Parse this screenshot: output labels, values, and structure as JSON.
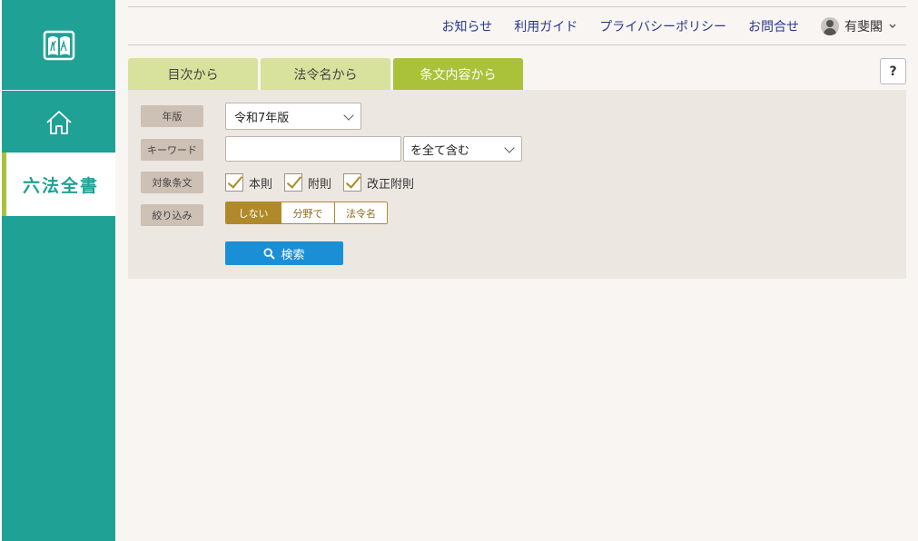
{
  "sidebar": {
    "logo_icon": "book-emblem-icon",
    "home_icon": "home-icon",
    "active_item": "六法全書"
  },
  "header": {
    "nav": [
      "お知らせ",
      "利用ガイド",
      "プライバシーポリシー",
      "お問合せ"
    ],
    "user_name": "有斐閣"
  },
  "tabs": [
    {
      "label": "目次から",
      "active": false
    },
    {
      "label": "法令名から",
      "active": false
    },
    {
      "label": "条文内容から",
      "active": true
    }
  ],
  "help_label": "?",
  "form": {
    "edition_label": "年版",
    "edition_value": "令和7年版",
    "keyword_label": "キーワード",
    "keyword_value": "",
    "match_mode": "を全て含む",
    "target_label": "対象条文",
    "targets": [
      "本則",
      "附則",
      "改正附則"
    ],
    "filter_label": "絞り込み",
    "filter_options": [
      "しない",
      "分野で",
      "法令名"
    ],
    "filter_selected": "しない",
    "search_label": "検索"
  },
  "colors": {
    "sidebar": "#1fa195",
    "tab_active": "#a9c23a",
    "tab_inactive": "#d8e29d",
    "panel": "#ede7e1",
    "accent_gold": "#b08a2a",
    "search_button": "#1b8fd6",
    "nav_link": "#2b3a8c"
  }
}
